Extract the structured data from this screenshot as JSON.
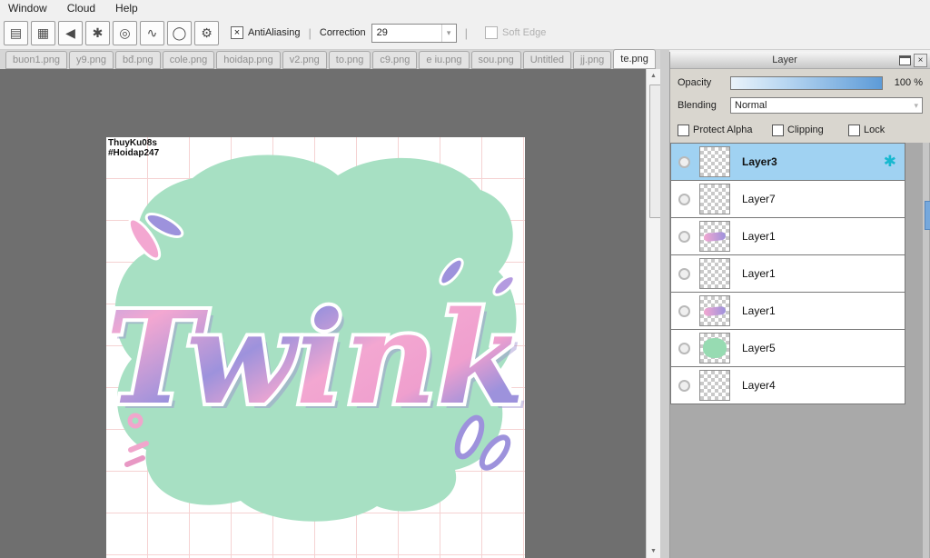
{
  "menu": {
    "items": [
      "Window",
      "Cloud",
      "Help"
    ]
  },
  "toolbar": {
    "antialiasing_label": "AntiAliasing",
    "correction_label": "Correction",
    "correction_value": "29",
    "soft_edge_label": "Soft Edge"
  },
  "tabs": [
    {
      "label": "buon1.png"
    },
    {
      "label": "y9.png"
    },
    {
      "label": "bđ.png"
    },
    {
      "label": "cole.png"
    },
    {
      "label": "hoidap.png"
    },
    {
      "label": "v2.png"
    },
    {
      "label": "to.png"
    },
    {
      "label": "c9.png"
    },
    {
      "label": "e iu.png"
    },
    {
      "label": "sou.png"
    },
    {
      "label": "Untitled"
    },
    {
      "label": "jj.png"
    },
    {
      "label": "te.png"
    }
  ],
  "canvas": {
    "watermark_line1": "ThuyKu08s",
    "watermark_line2": "#Hoidap247",
    "artwork_text": "Twink"
  },
  "layer_panel": {
    "title": "Layer",
    "opacity_label": "Opacity",
    "opacity_value": "100 %",
    "blending_label": "Blending",
    "blending_value": "Normal",
    "checkbox_labels": [
      "Protect Alpha",
      "Clipping",
      "Lock"
    ],
    "layers": [
      {
        "name": "Layer3",
        "selected": true
      },
      {
        "name": "Layer7"
      },
      {
        "name": "Layer1"
      },
      {
        "name": "Layer1"
      },
      {
        "name": "Layer1"
      },
      {
        "name": "Layer5"
      },
      {
        "name": "Layer4"
      }
    ]
  },
  "icons": {
    "tool_hatch": "▤",
    "tool_grid": "▦",
    "tool_arrow": "◀",
    "tool_star": "✱",
    "tool_rings": "◎",
    "tool_curve": "∿",
    "tool_circle": "◯",
    "tool_gear": "⚙",
    "checkbox_mark": "×",
    "dropdown_arrow": "▾",
    "scroll_up": "▲",
    "scroll_down": "▼",
    "close": "×",
    "layer_effect": "✱"
  },
  "colors": {
    "selected_layer_blue": "#a0d2f2",
    "slider_blue": "#5d9bd8",
    "effect_teal": "#17b8cf",
    "mint_green": "#a7e0c3",
    "art_pink": "#f3a7d1",
    "art_purple": "#9d92dc"
  }
}
